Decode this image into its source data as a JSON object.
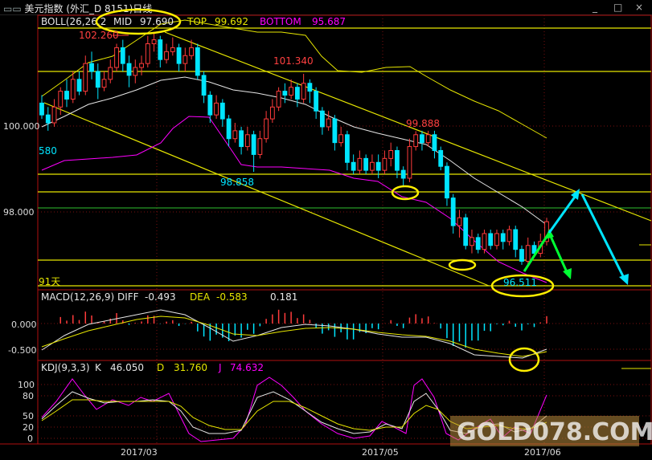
{
  "window": {
    "title": "美元指数 (外汇_D 8151)日线",
    "title_icon": "chart-icon",
    "controls": [
      "_",
      "□",
      "×"
    ]
  },
  "indicators": {
    "boll": {
      "label": "BOLL(26,26,2",
      "mid_label": "MID",
      "mid": "97.690",
      "top_label": "TOP",
      "top": "99.692",
      "bottom_label": "BOTTOM",
      "bottom": "95.687"
    },
    "macd": {
      "label": "MACD(12,26,9)",
      "diff_label": "DIFF",
      "diff": "-0.493",
      "dea_label": "DEA",
      "dea": "-0.583",
      "macd": "0.181"
    },
    "kdj": {
      "label": "KDJ(9,3,3)",
      "k_label": "K",
      "k": "46.050",
      "d_label": "D",
      "d": "31.760",
      "j_label": "J",
      "j": "74.632"
    }
  },
  "price_annotations": [
    "102.260",
    "101.340",
    "99.888",
    "98.858",
    "96.511"
  ],
  "side_labels": {
    "left_580": "580",
    "days": "91天"
  },
  "axes": {
    "price_ticks": [
      "100.000",
      "98.000"
    ],
    "macd_ticks": [
      "0.000",
      "-0.500"
    ],
    "kdj_ticks": [
      "100",
      "80",
      "50",
      "20",
      "0"
    ],
    "x_ticks": [
      "2017/03",
      "2017/05",
      "2017/06"
    ]
  },
  "watermark": "GOLD078.COM",
  "colors": {
    "up": "#ff3b3b",
    "down": "#00e5ff",
    "mid": "#e6e6e6",
    "top": "#e6e600",
    "bottom": "#ff00ff",
    "annot": "#ffee00",
    "arrow_cyan": "#00e5ff",
    "arrow_green": "#00ff33"
  },
  "chart_data": {
    "type": "candlestick",
    "price_range": [
      96.0,
      102.8
    ],
    "candles": [
      [
        100.6,
        100.3,
        100.8,
        100.2
      ],
      [
        100.3,
        100.1,
        100.5,
        99.9
      ],
      [
        100.1,
        100.5,
        100.7,
        100.0
      ],
      [
        100.5,
        100.9,
        101.0,
        100.3
      ],
      [
        100.9,
        100.7,
        101.2,
        100.5
      ],
      [
        100.7,
        101.2,
        101.4,
        100.6
      ],
      [
        101.2,
        100.9,
        101.4,
        100.8
      ],
      [
        100.9,
        101.6,
        101.8,
        100.8
      ],
      [
        101.6,
        101.4,
        101.9,
        101.2
      ],
      [
        101.4,
        101.0,
        101.6,
        100.7
      ],
      [
        101.0,
        101.2,
        101.4,
        100.9
      ],
      [
        101.2,
        101.5,
        101.7,
        101.1
      ],
      [
        101.5,
        102.0,
        102.1,
        101.4
      ],
      [
        102.0,
        101.6,
        102.2,
        101.4
      ],
      [
        101.6,
        101.3,
        101.8,
        101.0
      ],
      [
        101.3,
        101.5,
        101.7,
        101.1
      ],
      [
        101.5,
        101.6,
        101.8,
        101.3
      ],
      [
        101.6,
        102.1,
        102.3,
        101.5
      ],
      [
        102.1,
        102.2,
        102.4,
        101.9
      ],
      [
        102.2,
        101.7,
        102.3,
        101.5
      ],
      [
        101.7,
        101.9,
        102.1,
        101.6
      ],
      [
        101.9,
        102.0,
        102.26,
        101.8
      ],
      [
        102.0,
        101.6,
        102.1,
        101.4
      ],
      [
        101.6,
        101.8,
        102.0,
        101.4
      ],
      [
        101.8,
        102.0,
        102.2,
        101.7
      ],
      [
        102.0,
        101.3,
        102.1,
        101.2
      ],
      [
        101.3,
        100.8,
        101.4,
        100.6
      ],
      [
        100.8,
        100.3,
        100.9,
        100.1
      ],
      [
        100.3,
        100.6,
        100.8,
        100.2
      ],
      [
        100.6,
        100.2,
        100.7,
        100.0
      ],
      [
        100.2,
        99.7,
        100.3,
        99.5
      ],
      [
        99.7,
        99.9,
        100.1,
        99.6
      ],
      [
        99.9,
        99.5,
        100.0,
        99.3
      ],
      [
        99.5,
        99.8,
        100.0,
        99.4
      ],
      [
        99.8,
        99.3,
        99.9,
        98.86
      ],
      [
        99.3,
        99.7,
        99.9,
        99.2
      ],
      [
        99.7,
        100.2,
        100.4,
        99.6
      ],
      [
        100.2,
        100.5,
        100.7,
        100.1
      ],
      [
        100.5,
        100.9,
        101.0,
        100.4
      ],
      [
        100.9,
        100.8,
        101.1,
        100.6
      ],
      [
        100.8,
        101.0,
        101.2,
        100.7
      ],
      [
        101.0,
        100.7,
        101.1,
        100.5
      ],
      [
        100.7,
        101.1,
        101.34,
        100.6
      ],
      [
        101.1,
        100.9,
        101.2,
        100.6
      ],
      [
        100.9,
        100.4,
        101.0,
        100.2
      ],
      [
        100.4,
        100.0,
        100.5,
        99.8
      ],
      [
        100.0,
        100.2,
        100.4,
        99.9
      ],
      [
        100.2,
        99.6,
        100.3,
        99.4
      ],
      [
        99.6,
        99.8,
        100.0,
        99.5
      ],
      [
        99.8,
        99.1,
        99.9,
        98.9
      ],
      [
        99.1,
        98.9,
        99.3,
        98.8
      ],
      [
        98.9,
        99.2,
        99.4,
        98.8
      ],
      [
        99.2,
        98.9,
        99.3,
        98.8
      ],
      [
        98.9,
        99.1,
        99.3,
        98.8
      ],
      [
        99.1,
        98.9,
        99.3,
        98.7
      ],
      [
        98.9,
        99.2,
        99.4,
        98.8
      ],
      [
        99.2,
        99.4,
        99.6,
        99.0
      ],
      [
        99.4,
        98.9,
        99.5,
        98.7
      ],
      [
        98.9,
        98.7,
        99.0,
        98.5
      ],
      [
        98.7,
        99.5,
        99.7,
        98.6
      ],
      [
        99.5,
        99.8,
        99.89,
        99.4
      ],
      [
        99.8,
        99.6,
        99.9,
        99.4
      ],
      [
        99.6,
        99.8,
        99.9,
        99.5
      ],
      [
        99.8,
        99.4,
        99.9,
        99.2
      ],
      [
        99.4,
        99.0,
        99.5,
        98.9
      ],
      [
        99.0,
        98.2,
        99.1,
        98.0
      ],
      [
        98.2,
        97.5,
        98.3,
        97.3
      ],
      [
        97.5,
        97.7,
        97.9,
        97.2
      ],
      [
        97.7,
        97.0,
        97.8,
        96.9
      ],
      [
        97.0,
        97.2,
        97.4,
        96.8
      ],
      [
        97.2,
        96.9,
        97.3,
        96.8
      ],
      [
        96.9,
        97.3,
        97.4,
        96.8
      ],
      [
        97.3,
        97.0,
        97.4,
        96.9
      ],
      [
        97.0,
        97.3,
        97.4,
        96.9
      ],
      [
        97.3,
        97.1,
        97.4,
        96.9
      ],
      [
        97.1,
        97.4,
        97.5,
        97.0
      ],
      [
        97.4,
        96.9,
        97.5,
        96.7
      ],
      [
        96.9,
        96.6,
        97.0,
        96.51
      ],
      [
        96.6,
        97.0,
        97.2,
        96.5
      ],
      [
        97.0,
        96.8,
        97.1,
        96.7
      ],
      [
        96.8,
        97.1,
        97.3,
        96.7
      ],
      [
        97.1,
        97.6,
        97.7,
        97.0
      ]
    ]
  }
}
